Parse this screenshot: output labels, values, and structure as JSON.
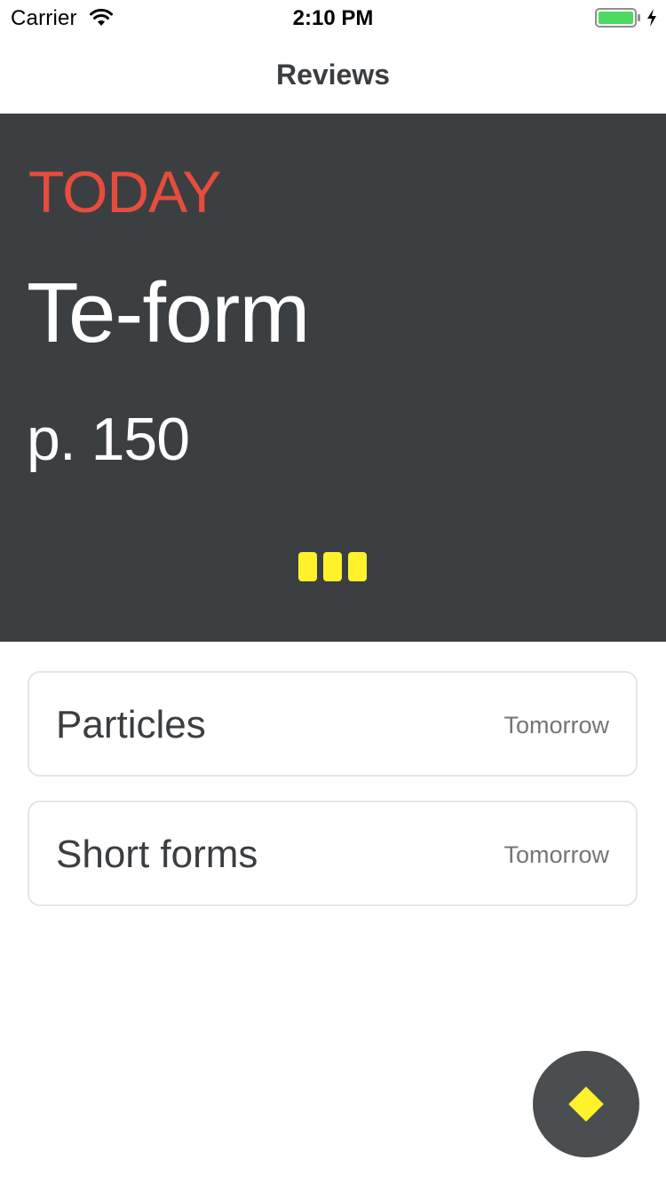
{
  "status_bar": {
    "carrier": "Carrier",
    "time": "2:10 PM",
    "battery_color": "#4cd964"
  },
  "nav": {
    "title": "Reviews"
  },
  "hero": {
    "label": "TODAY",
    "title": "Te-form",
    "page": "p. 150",
    "label_color": "#e74c3c",
    "background": "#3b3f42",
    "progress_blocks": 3,
    "progress_color": "#fff22b"
  },
  "reviews": [
    {
      "name": "Particles",
      "when": "Tomorrow"
    },
    {
      "name": "Short forms",
      "when": "Tomorrow"
    }
  ],
  "fab": {
    "icon": "diamond-icon",
    "color": "#fff22b"
  }
}
